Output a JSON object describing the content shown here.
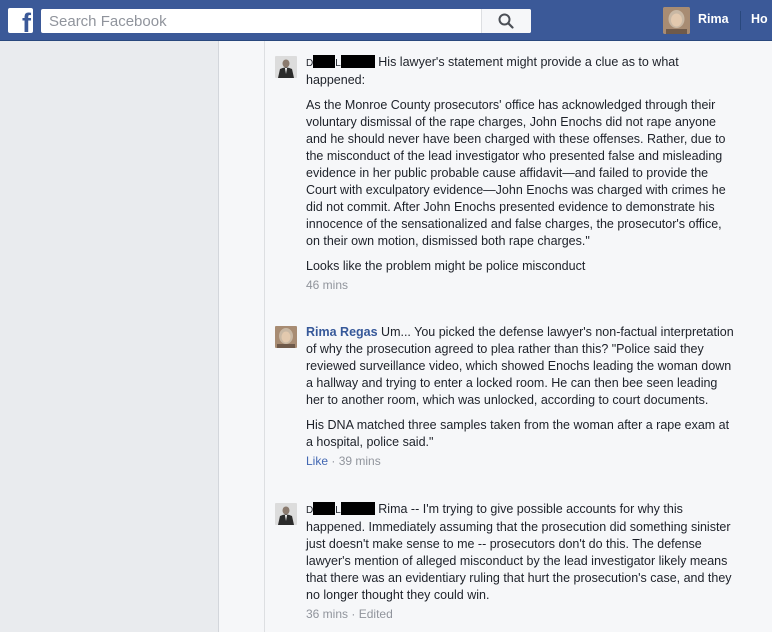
{
  "topbar": {
    "logo": "f",
    "search_placeholder": "Search Facebook",
    "profile_name": "Rima",
    "home_label": "Ho"
  },
  "comments": [
    {
      "author_initial": "D",
      "author_initial2": "L",
      "author_redacted": true,
      "lead": "His lawyer's statement might provide a clue as to what happened:",
      "quote": "As the Monroe County prosecutors' office has acknowledged through their voluntary dismissal of the rape charges, John Enochs did not rape anyone and he should never have been charged with these offenses. Rather, due to the misconduct of the lead investigator who presented false and misleading evidence in her public probable cause affidavit—and failed to provide the Court with exculpatory evidence—John Enochs was charged with crimes he did not commit. After John Enochs presented evidence to demonstrate his innocence of the sensationalized and false charges, the prosecutor's office, on their own motion, dismissed both rape charges.\"",
      "tail": "Looks like the problem might be police misconduct",
      "time": "46 mins"
    },
    {
      "author": "Rima Regas",
      "lead": "Um... You picked the defense lawyer's non-factual interpretation of why the prosecution agreed to plea rather than this? \"Police said they reviewed surveillance video, which showed Enochs leading the woman down a hallway and trying to enter a locked room. He can then bee seen leading her to another room, which was unlocked, according to court documents.",
      "tail": "His DNA matched three samples taken from the woman after a rape exam at a hospital, police said.\"",
      "like": "Like",
      "sep": "·",
      "time": "39 mins"
    },
    {
      "author_initial": "D",
      "author_initial2": "L",
      "author_redacted": true,
      "lead": "Rima -- I'm trying to give possible accounts for why this happened. Immediately assuming that the prosecution did something sinister just doesn't make sense to me -- prosecutors don't do this. The defense lawyer's mention of alleged misconduct by the lead investigator likely means that there was an evidentiary ruling that hurt the prosecution's case, and they no longer thought they could win.",
      "time": "36 mins",
      "sep": "·",
      "edited": "Edited"
    }
  ],
  "colors": {
    "topbar": "#3b5998",
    "link": "#365899",
    "meta": "#90949c",
    "background": "#e9ebee",
    "comments_bg": "#f6f7f9"
  }
}
